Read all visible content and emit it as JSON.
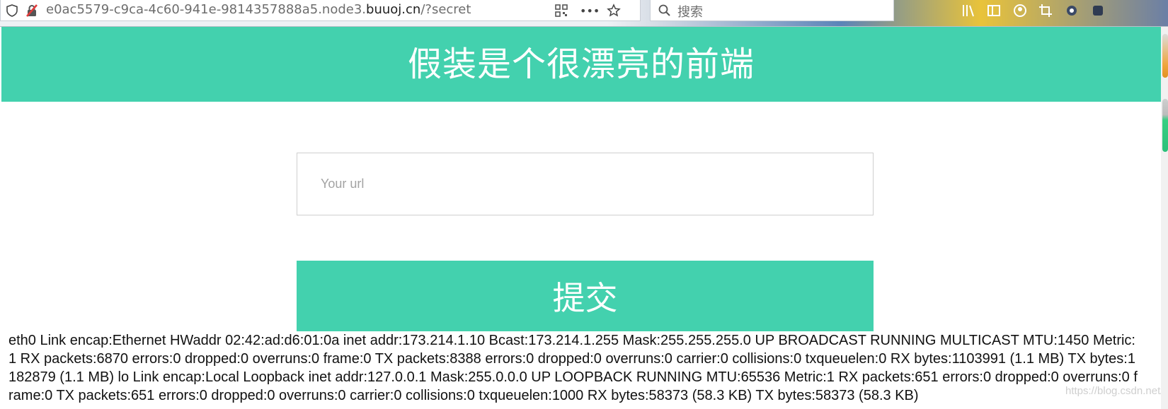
{
  "browser": {
    "url_prefix": "e0ac5579-c9ca-4c60-941e-9814357888a5.node3.",
    "url_domain": "buuoj.cn",
    "url_suffix": "/?secret",
    "search_placeholder": "搜索",
    "more_icon_text": "•••"
  },
  "page": {
    "header_title": "假装是个很漂亮的前端",
    "url_input_placeholder": "Your url",
    "submit_label": "提交",
    "output_text": "eth0 Link encap:Ethernet HWaddr 02:42:ad:d6:01:0a inet addr:173.214.1.10 Bcast:173.214.1.255 Mask:255.255.255.0 UP BROADCAST RUNNING MULTICAST MTU:1450 Metric:1 RX packets:6870 errors:0 dropped:0 overruns:0 frame:0 TX packets:8388 errors:0 dropped:0 overruns:0 carrier:0 collisions:0 txqueuelen:0 RX bytes:1103991 (1.1 MB) TX bytes:1182879 (1.1 MB) lo Link encap:Local Loopback inet addr:127.0.0.1 Mask:255.0.0.0 UP LOOPBACK RUNNING MTU:65536 Metric:1 RX packets:651 errors:0 dropped:0 overruns:0 frame:0 TX packets:651 errors:0 dropped:0 overruns:0 carrier:0 collisions:0 txqueuelen:1000 RX bytes:58373 (58.3 KB) TX bytes:58373 (58.3 KB)",
    "watermark": "https://blog.csdn.net/crisprx"
  },
  "colors": {
    "accent": "#43d1ae",
    "scroll_orange": "#f0a640",
    "scroll_green": "#2cc07a"
  }
}
